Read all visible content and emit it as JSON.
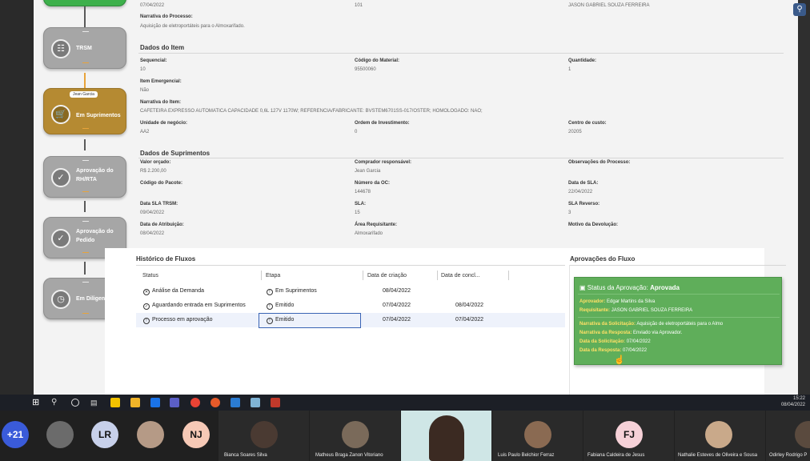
{
  "workflow": {
    "steps": [
      {
        "label": "TRSM",
        "icon": "document-icon"
      },
      {
        "label": "Em Suprimentos",
        "icon": "cart-icon",
        "assignee": "Jean Garcia"
      },
      {
        "label": "Aprovação do RH/RTA",
        "icon": "calendar-check-icon"
      },
      {
        "label": "Aprovação do Pedido",
        "icon": "calendar-check-icon"
      },
      {
        "label": "Em Diligenc...",
        "icon": "clock-icon"
      }
    ]
  },
  "process_top": {
    "date": "07/04/2022",
    "number": "101",
    "name": "JASON GABRIEL SOUZA FERREIRA",
    "narrative_label": "Narrativa do Processo:",
    "narrative_value": "Aquisição de eletroportáteis para o Almoxarifado."
  },
  "item": {
    "title": "Dados do Item",
    "sequencial_label": "Sequencial:",
    "sequencial": "10",
    "codigo_label": "Código do Material:",
    "codigo": "95500060",
    "quantidade_label": "Quantidade:",
    "quantidade": "1",
    "emergencial_label": "Item Emergencial:",
    "emergencial": "Não",
    "narrativa_label": "Narrativa do Item:",
    "narrativa": "CAFETEIRA EXPRESSO AUTOMATICA CAPACIDADE 0,6L 127V 1170W; REFERENCIA/FABRICANTE: BVSTEM6701SS-017/OSTER; HOMOLOGADO: NAO;",
    "unidade_label": "Unidade de negócio:",
    "unidade": "AA2",
    "ordem_label": "Ordem de Investimento:",
    "ordem": "0",
    "centro_label": "Centro de custo:",
    "centro": "20205"
  },
  "supplies": {
    "title": "Dados de Suprimentos",
    "valor_label": "Valor orçado:",
    "valor": "R$ 2.200,00",
    "comprador_label": "Comprador responsável:",
    "comprador": "Jean Garcia",
    "obs_label": "Observações do Processo:",
    "pacote_label": "Código do Pacote:",
    "oc_label": "Número da OC:",
    "oc": "144678",
    "data_sla_label": "Data de SLA:",
    "data_sla": "22/04/2022",
    "sla_trsm_label": "Data SLA TRSM:",
    "sla_trsm": "09/04/2022",
    "sla_label": "SLA:",
    "sla": "15",
    "sla_rev_label": "SLA Reverso:",
    "sla_rev": "3",
    "atrib_label": "Data de Atribuição:",
    "atrib": "08/04/2022",
    "area_label": "Área Requisitante:",
    "area": "Almoxarifado",
    "motivo_label": "Motivo da Devolução:"
  },
  "history": {
    "title": "Histórico de Fluxos",
    "columns": [
      "Status",
      "Etapa",
      "Data de criação",
      "Data de concl..."
    ],
    "rows": [
      {
        "status": "Análise da Demanda",
        "status_icon": "x-circle-icon",
        "etapa": "Em Suprimentos",
        "criacao": "08/04/2022",
        "conclusao": ""
      },
      {
        "status": "Aguardando entrada em Suprimentos",
        "status_icon": "check-circle-icon",
        "etapa": "Emitido",
        "criacao": "07/04/2022",
        "conclusao": "08/04/2022"
      },
      {
        "status": "Processo em aprovação",
        "status_icon": "alert-circle-icon",
        "etapa": "Emitido",
        "criacao": "07/04/2022",
        "conclusao": "07/04/2022"
      }
    ]
  },
  "approvals": {
    "title": "Aprovações do Fluxo",
    "status_label": "Status da Aprovação:",
    "status": "Aprovada",
    "aprovador_label": "Aprovador:",
    "aprovador": "Edgar Martins da Silva",
    "requisitante_label": "Requisitante:",
    "requisitante": "JASON GABRIEL SOUZA FERREIRA",
    "narr_sol_label": "Narrativa da Solicitação:",
    "narr_sol": "Aquisição de eletroportáteis para o Almo",
    "narr_resp_label": "Narrativa da Resposta:",
    "narr_resp": "Enviado via Aprovador.",
    "data_sol_label": "Data da Solicitação:",
    "data_sol": "07/04/2022",
    "data_resp_label": "Data da Resposta:",
    "data_resp": "07/04/2022"
  },
  "taskbar": {
    "time": "15:22",
    "date": "08/04/2022"
  },
  "participants": {
    "overflow": "+21",
    "initials": [
      "LR",
      "NJ",
      "FJ"
    ],
    "names": [
      "Bianca Soares Silva",
      "Matheus Braga Zanon Vitoriano",
      "Luis Paulo Belchior Ferraz",
      "Fabiana Caldeira de Jesus",
      "Nathalie Esteves de Oliveira e Sousa",
      "Odirley Rodrigo P"
    ]
  },
  "colors": {
    "approval_bg": "#5fae5a",
    "active_step": "#b58a32",
    "accent_line": "#e8a33a"
  }
}
